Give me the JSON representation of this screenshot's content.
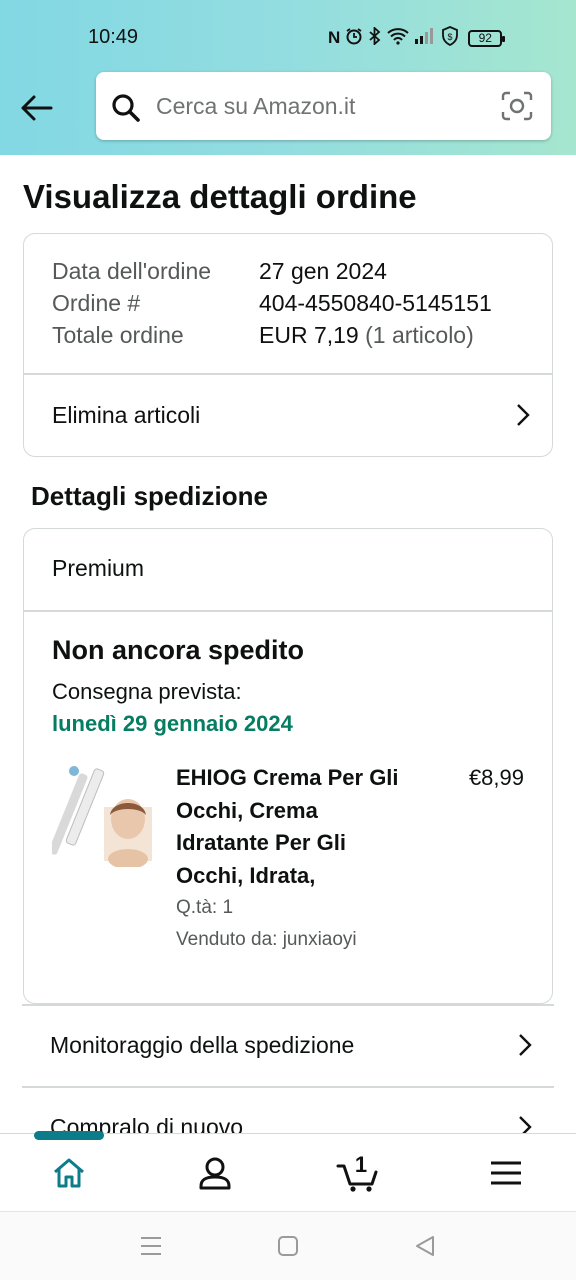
{
  "status_bar": {
    "time": "10:49",
    "battery": "92",
    "icons": [
      "nfc-icon",
      "alarm-icon",
      "bluetooth-icon",
      "wifi-icon",
      "signal-icon",
      "vpn-icon",
      "battery-icon"
    ]
  },
  "search": {
    "placeholder": "Cerca su Amazon.it"
  },
  "page_title": "Visualizza dettagli ordine",
  "order_summary": {
    "date_label": "Data dell'ordine",
    "date_value": "27 gen 2024",
    "number_label": "Ordine #",
    "number_value": "404-4550840-5145151",
    "total_label": "Totale ordine",
    "total_value": "EUR 7,19",
    "total_items": "(1 articolo)",
    "delete_link": "Elimina articoli"
  },
  "shipping": {
    "section_title": "Dettagli spedizione",
    "plan": "Premium",
    "status": "Non ancora spedito",
    "expected_label": "Consegna prevista:",
    "expected_date": "lunedì 29 gennaio 2024",
    "product": {
      "name": "EHIOG Crema Per Gli Occhi, Crema Idratante Per Gli Occhi, Idrata,",
      "price": "€8,99",
      "qty": "Q.tà: 1",
      "seller": "Venduto da: junxiaoyi"
    }
  },
  "links": {
    "tracking": "Monitoraggio della spedizione",
    "buy_again": "Compralo di nuovo"
  },
  "bottom_nav": {
    "cart_count": "1",
    "items": [
      "home-icon",
      "account-icon",
      "cart-icon",
      "menu-icon"
    ],
    "active": "home-icon",
    "accent_color": "#0d7c8a"
  },
  "colors": {
    "delivery_green": "#067d62",
    "divider": "#d5d9d9"
  }
}
